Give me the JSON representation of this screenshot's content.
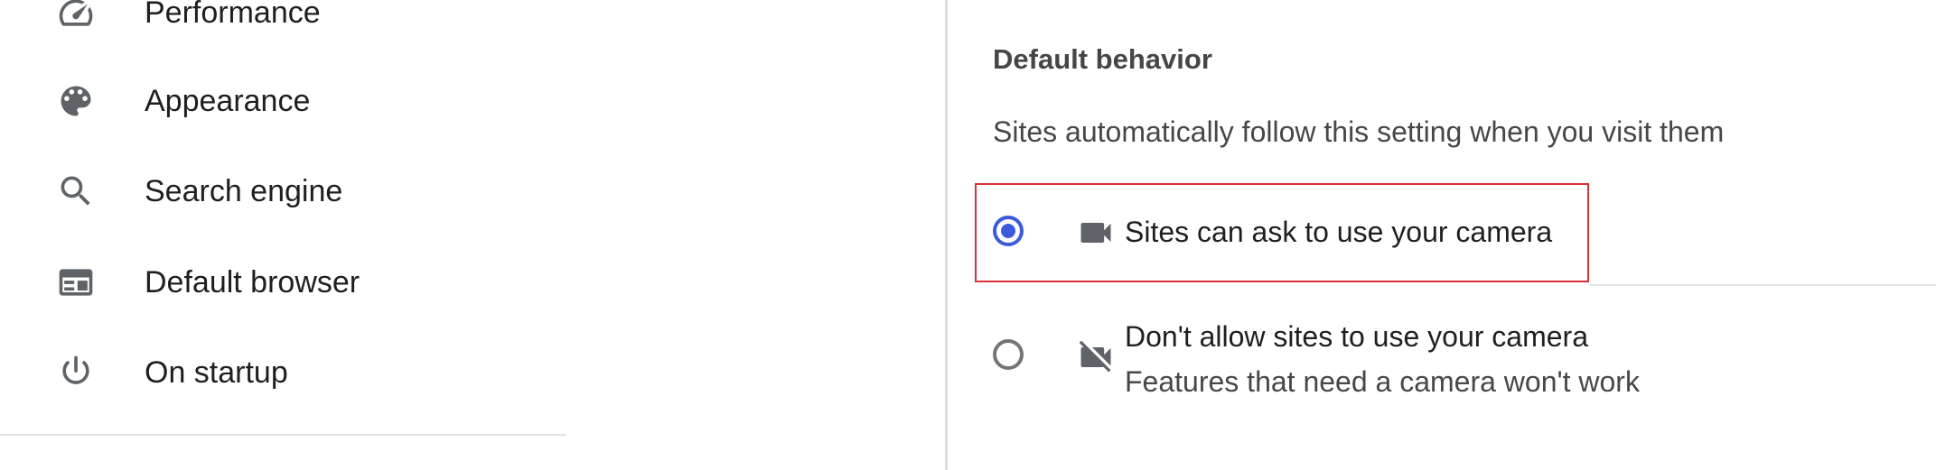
{
  "sidebar": {
    "items": [
      {
        "label": "Performance",
        "icon": "speedometer-icon"
      },
      {
        "label": "Appearance",
        "icon": "palette-icon"
      },
      {
        "label": "Search engine",
        "icon": "search-icon"
      },
      {
        "label": "Default browser",
        "icon": "browser-window-icon"
      },
      {
        "label": "On startup",
        "icon": "power-icon"
      }
    ]
  },
  "main": {
    "section_title": "Default behavior",
    "section_description": "Sites automatically follow this setting when you visit them",
    "options": [
      {
        "label": "Sites can ask to use your camera",
        "selected": true,
        "icon": "videocam-icon"
      },
      {
        "label": "Don't allow sites to use your camera",
        "sublabel": "Features that need a camera won't work",
        "selected": false,
        "icon": "videocam-off-icon"
      }
    ]
  },
  "colors": {
    "accent": "#3b5bdb",
    "highlight_border": "#d9323a",
    "icon": "#5f6368"
  }
}
